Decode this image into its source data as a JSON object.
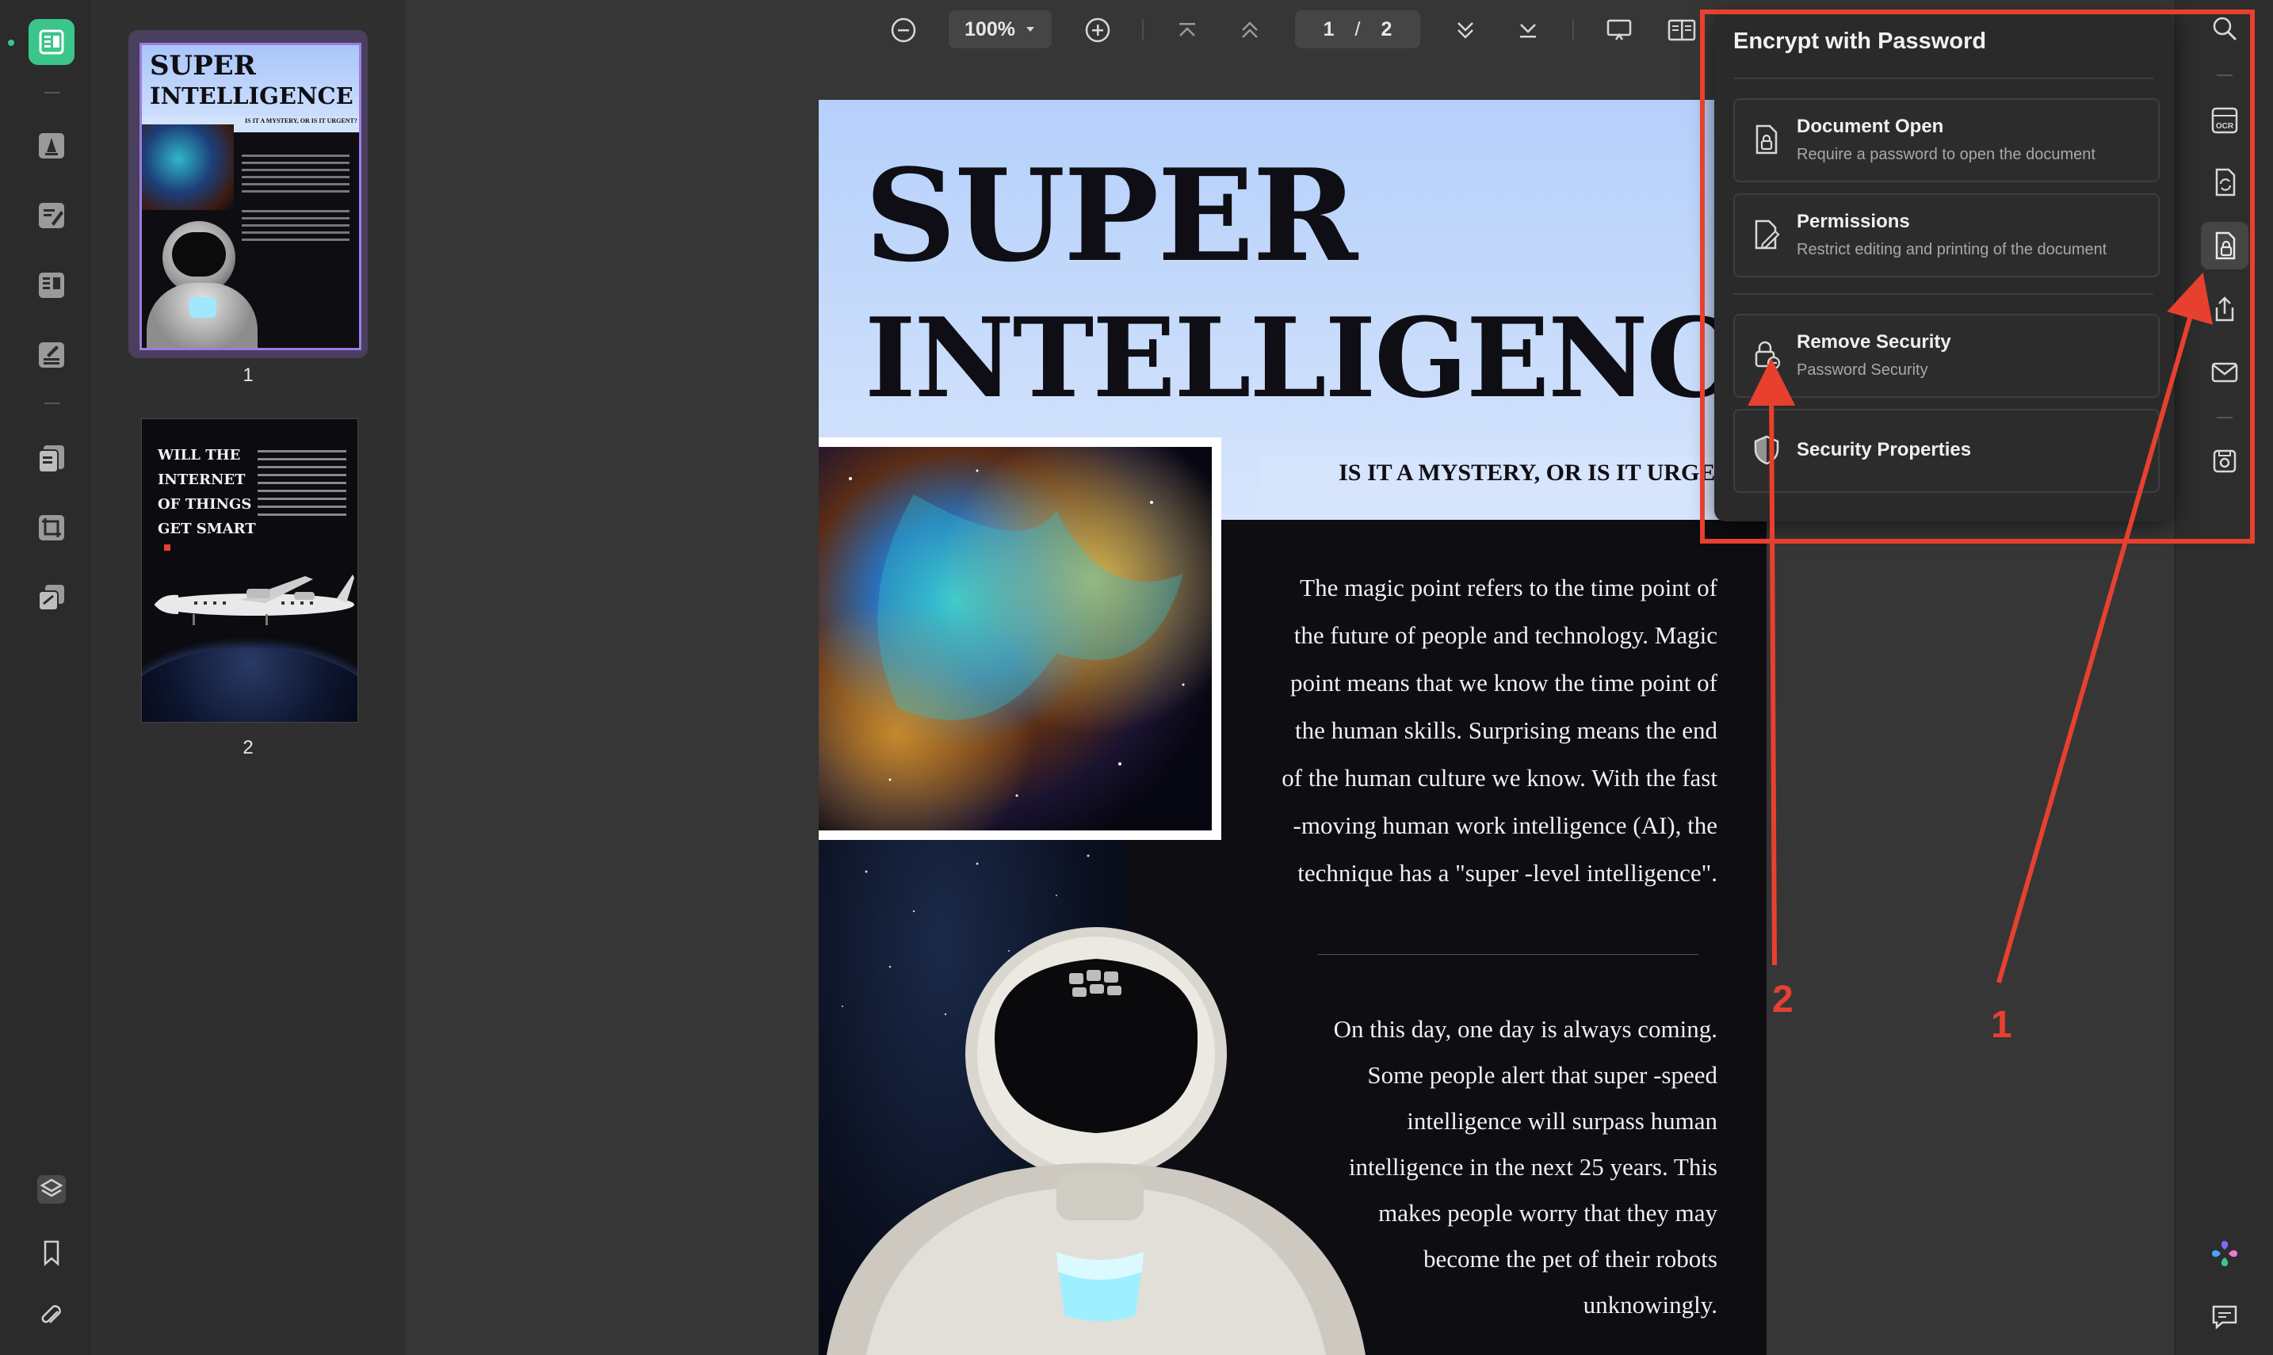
{
  "toolbar": {
    "zoom_value": "100%",
    "current_page": "1",
    "page_separator": "/",
    "total_pages": "2"
  },
  "thumbnails": [
    {
      "number": "1",
      "title_line1": "SUPER",
      "title_line2": "INTELLIGENCE",
      "subtitle": "IS IT A MYSTERY, OR IS IT URGENT?"
    },
    {
      "number": "2",
      "title_lines": [
        "WILL THE",
        "INTERNET",
        "OF THINGS",
        "GET SMART"
      ]
    }
  ],
  "document": {
    "title_line1": "SUPER",
    "title_line2": "INTELLIGENCE",
    "subtitle": "IS IT A MYSTERY, OR IS IT URGENT?",
    "paragraph1_lines": [
      "The magic point refers to the time point of",
      "the future of people and technology. Magic",
      "point means that we know the time point of",
      "the human skills. Surprising means the end",
      "of the human culture we know. With the fast",
      "-moving human work intelligence (AI), the",
      "technique has a \"super -level intelligence\"."
    ],
    "paragraph2_lines": [
      "On this day, one day is always coming.",
      "Some people alert that super -speed",
      "intelligence will surpass human",
      "intelligence in the next 25 years. This",
      "makes people worry that they may",
      "become the pet of their robots",
      "unknowingly."
    ]
  },
  "popover": {
    "title": "Encrypt with Password",
    "items": [
      {
        "title": "Document Open",
        "subtitle": "Require a password to open the document"
      },
      {
        "title": "Permissions",
        "subtitle": "Restrict editing and printing of the document"
      },
      {
        "title": "Remove Security",
        "subtitle": "Password Security"
      },
      {
        "title": "Security Properties",
        "subtitle": ""
      }
    ]
  },
  "annotations": {
    "label_1": "1",
    "label_2": "2",
    "color": "#e8402e"
  },
  "colors": {
    "accent_green": "#3cc58a",
    "page_sky_blue": "#c8dcfb",
    "annotation_red": "#e8402e"
  }
}
